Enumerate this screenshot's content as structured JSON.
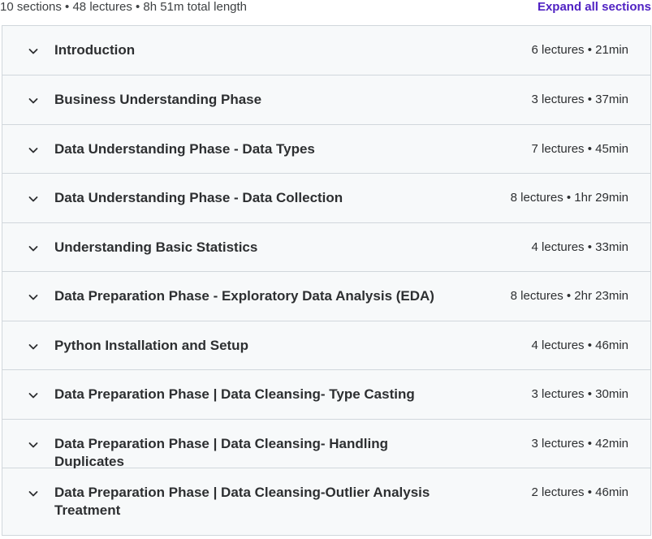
{
  "summary": {
    "text": "10 sections • 48 lectures • 8h 51m total length",
    "expand_label": "Expand all sections"
  },
  "sections": [
    {
      "title": "Introduction",
      "meta": "6 lectures • 21min"
    },
    {
      "title": "Business Understanding Phase",
      "meta": "3 lectures • 37min"
    },
    {
      "title": "Data Understanding Phase - Data Types",
      "meta": "7 lectures • 45min"
    },
    {
      "title": "Data Understanding Phase - Data Collection",
      "meta": "8 lectures • 1hr 29min"
    },
    {
      "title": "Understanding Basic Statistics",
      "meta": "4 lectures • 33min"
    },
    {
      "title": "Data Preparation Phase - Exploratory Data Analysis (EDA)",
      "meta": "8 lectures • 2hr 23min"
    },
    {
      "title": "Python Installation and Setup",
      "meta": "4 lectures • 46min"
    },
    {
      "title": "Data Preparation Phase | Data Cleansing- Type Casting",
      "meta": "3 lectures • 30min"
    },
    {
      "title": "Data Preparation Phase | Data Cleansing- Handling Duplicates",
      "meta": "3 lectures • 42min"
    },
    {
      "title": "Data Preparation Phase | Data Cleansing-Outlier Analysis Treatment",
      "meta": "2 lectures • 46min"
    }
  ],
  "icons": {
    "section_toggle": "chevron-down-icon"
  },
  "colors": {
    "accent": "#5022c3",
    "section_bg": "#f7f9fa",
    "border": "#d1d7dc"
  }
}
